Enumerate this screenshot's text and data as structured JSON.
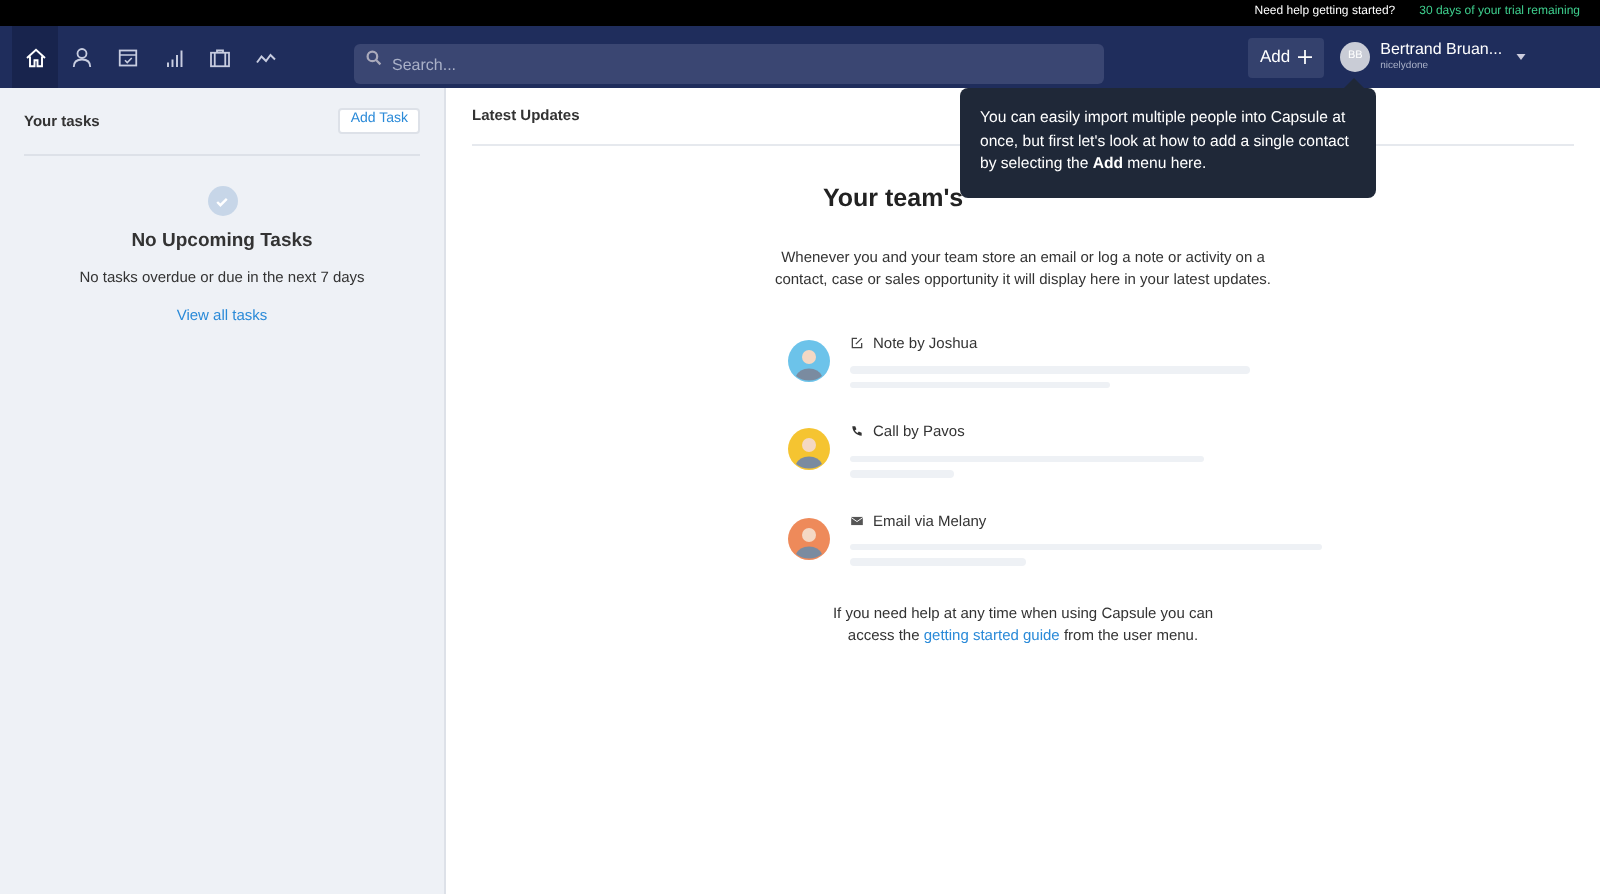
{
  "top_bar": {
    "help": "Need help getting started?",
    "trial": "30 days of your trial remaining"
  },
  "nav": {
    "items": [
      {
        "kind": "home",
        "selected": true
      },
      {
        "kind": "person",
        "selected": false
      },
      {
        "kind": "calendar",
        "selected": false
      },
      {
        "kind": "bars",
        "selected": false
      },
      {
        "kind": "case",
        "selected": false
      },
      {
        "kind": "trend",
        "selected": false
      }
    ],
    "search": {
      "placeholder": "Search..."
    },
    "add_button": "Add",
    "user": {
      "initials": "BB",
      "name": "Bertrand Bruan...",
      "account": "nicelydone"
    }
  },
  "tasks": {
    "title": "Your tasks",
    "add_button": "Add Task",
    "empty_title": "No Upcoming Tasks",
    "empty_text": "No tasks overdue or due in the next 7 days",
    "link": "View all tasks"
  },
  "updates": {
    "title": "Latest Updates",
    "heading": "Your team's",
    "intro": "Whenever you and your team store an email or log a note or activity on a contact, case or sales opportunity it will display here in your latest updates.",
    "items": [
      {
        "kind": "note",
        "label": "Note by Joshua",
        "color": "#6cc3ea"
      },
      {
        "kind": "call",
        "label": "Call by Pavos",
        "color": "#f5c431"
      },
      {
        "kind": "email",
        "label": "Email via Melany",
        "color": "#ee8a5a"
      }
    ],
    "help_before": "If you need help at any time when using Capsule you can access the",
    "help_link": "getting started guide",
    "help_after": "from the user menu."
  },
  "tooltip": "You can easily import multiple people into Capsule at once, but first let's look at how to add a single contact by selecting the **Add** menu here."
}
